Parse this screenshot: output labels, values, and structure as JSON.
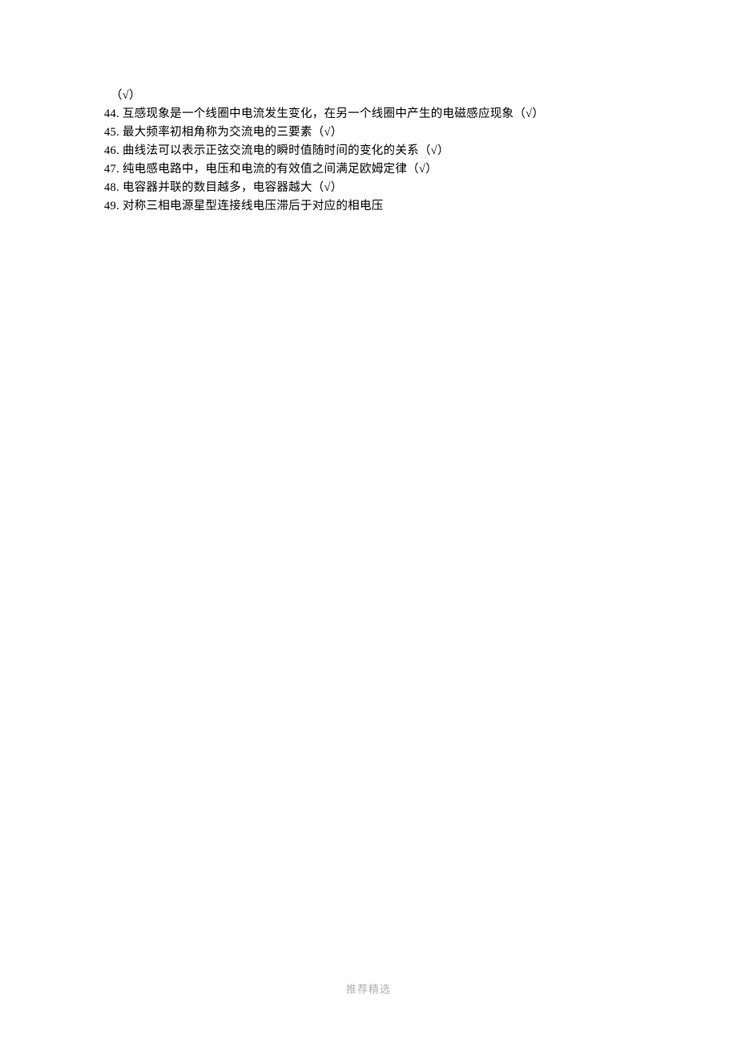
{
  "lines": [
    "（√）",
    "44. 互感现象是一个线圈中电流发生变化，在另一个线圈中产生的电磁感应现象（√）",
    "45. 最大频率初相角称为交流电的三要素（√）",
    "46. 曲线法可以表示正弦交流电的瞬时值随时间的变化的关系（√）",
    "47. 纯电感电路中，电压和电流的有效值之间满足欧姆定律（√）",
    "48. 电容器并联的数目越多，电容器越大（√）",
    "49. 对称三相电源星型连接线电压滞后于对应的相电压"
  ],
  "footer": "推荐精选"
}
